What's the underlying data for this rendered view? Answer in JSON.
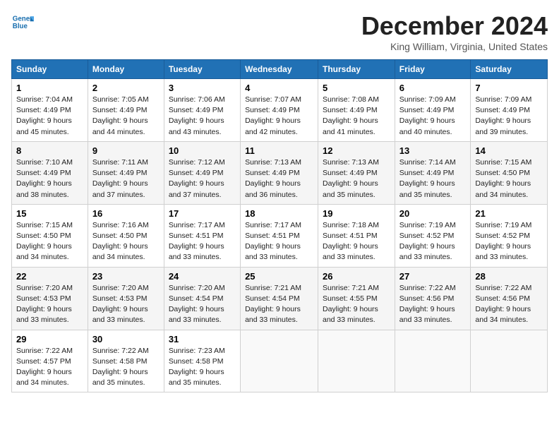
{
  "header": {
    "logo_line1": "General",
    "logo_line2": "Blue",
    "month": "December 2024",
    "location": "King William, Virginia, United States"
  },
  "weekdays": [
    "Sunday",
    "Monday",
    "Tuesday",
    "Wednesday",
    "Thursday",
    "Friday",
    "Saturday"
  ],
  "weeks": [
    [
      {
        "day": "1",
        "sunrise": "7:04 AM",
        "sunset": "4:49 PM",
        "daylight": "9 hours and 45 minutes."
      },
      {
        "day": "2",
        "sunrise": "7:05 AM",
        "sunset": "4:49 PM",
        "daylight": "9 hours and 44 minutes."
      },
      {
        "day": "3",
        "sunrise": "7:06 AM",
        "sunset": "4:49 PM",
        "daylight": "9 hours and 43 minutes."
      },
      {
        "day": "4",
        "sunrise": "7:07 AM",
        "sunset": "4:49 PM",
        "daylight": "9 hours and 42 minutes."
      },
      {
        "day": "5",
        "sunrise": "7:08 AM",
        "sunset": "4:49 PM",
        "daylight": "9 hours and 41 minutes."
      },
      {
        "day": "6",
        "sunrise": "7:09 AM",
        "sunset": "4:49 PM",
        "daylight": "9 hours and 40 minutes."
      },
      {
        "day": "7",
        "sunrise": "7:09 AM",
        "sunset": "4:49 PM",
        "daylight": "9 hours and 39 minutes."
      }
    ],
    [
      {
        "day": "8",
        "sunrise": "7:10 AM",
        "sunset": "4:49 PM",
        "daylight": "9 hours and 38 minutes."
      },
      {
        "day": "9",
        "sunrise": "7:11 AM",
        "sunset": "4:49 PM",
        "daylight": "9 hours and 37 minutes."
      },
      {
        "day": "10",
        "sunrise": "7:12 AM",
        "sunset": "4:49 PM",
        "daylight": "9 hours and 37 minutes."
      },
      {
        "day": "11",
        "sunrise": "7:13 AM",
        "sunset": "4:49 PM",
        "daylight": "9 hours and 36 minutes."
      },
      {
        "day": "12",
        "sunrise": "7:13 AM",
        "sunset": "4:49 PM",
        "daylight": "9 hours and 35 minutes."
      },
      {
        "day": "13",
        "sunrise": "7:14 AM",
        "sunset": "4:49 PM",
        "daylight": "9 hours and 35 minutes."
      },
      {
        "day": "14",
        "sunrise": "7:15 AM",
        "sunset": "4:50 PM",
        "daylight": "9 hours and 34 minutes."
      }
    ],
    [
      {
        "day": "15",
        "sunrise": "7:15 AM",
        "sunset": "4:50 PM",
        "daylight": "9 hours and 34 minutes."
      },
      {
        "day": "16",
        "sunrise": "7:16 AM",
        "sunset": "4:50 PM",
        "daylight": "9 hours and 34 minutes."
      },
      {
        "day": "17",
        "sunrise": "7:17 AM",
        "sunset": "4:51 PM",
        "daylight": "9 hours and 33 minutes."
      },
      {
        "day": "18",
        "sunrise": "7:17 AM",
        "sunset": "4:51 PM",
        "daylight": "9 hours and 33 minutes."
      },
      {
        "day": "19",
        "sunrise": "7:18 AM",
        "sunset": "4:51 PM",
        "daylight": "9 hours and 33 minutes."
      },
      {
        "day": "20",
        "sunrise": "7:19 AM",
        "sunset": "4:52 PM",
        "daylight": "9 hours and 33 minutes."
      },
      {
        "day": "21",
        "sunrise": "7:19 AM",
        "sunset": "4:52 PM",
        "daylight": "9 hours and 33 minutes."
      }
    ],
    [
      {
        "day": "22",
        "sunrise": "7:20 AM",
        "sunset": "4:53 PM",
        "daylight": "9 hours and 33 minutes."
      },
      {
        "day": "23",
        "sunrise": "7:20 AM",
        "sunset": "4:53 PM",
        "daylight": "9 hours and 33 minutes."
      },
      {
        "day": "24",
        "sunrise": "7:20 AM",
        "sunset": "4:54 PM",
        "daylight": "9 hours and 33 minutes."
      },
      {
        "day": "25",
        "sunrise": "7:21 AM",
        "sunset": "4:54 PM",
        "daylight": "9 hours and 33 minutes."
      },
      {
        "day": "26",
        "sunrise": "7:21 AM",
        "sunset": "4:55 PM",
        "daylight": "9 hours and 33 minutes."
      },
      {
        "day": "27",
        "sunrise": "7:22 AM",
        "sunset": "4:56 PM",
        "daylight": "9 hours and 33 minutes."
      },
      {
        "day": "28",
        "sunrise": "7:22 AM",
        "sunset": "4:56 PM",
        "daylight": "9 hours and 34 minutes."
      }
    ],
    [
      {
        "day": "29",
        "sunrise": "7:22 AM",
        "sunset": "4:57 PM",
        "daylight": "9 hours and 34 minutes."
      },
      {
        "day": "30",
        "sunrise": "7:22 AM",
        "sunset": "4:58 PM",
        "daylight": "9 hours and 35 minutes."
      },
      {
        "day": "31",
        "sunrise": "7:23 AM",
        "sunset": "4:58 PM",
        "daylight": "9 hours and 35 minutes."
      },
      null,
      null,
      null,
      null
    ]
  ]
}
